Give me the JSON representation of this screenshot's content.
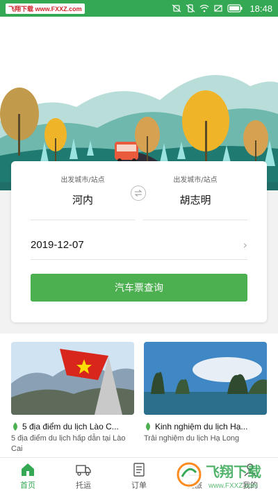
{
  "status_bar": {
    "watermark": "飞翔下载 www.FXXZ.com",
    "time": "18:48"
  },
  "search": {
    "from_label": "出发城市/站点",
    "from_city": "河内",
    "to_label": "出发城市/站点",
    "to_city": "胡志明",
    "date": "2019-12-07",
    "button_label": "汽车票查询"
  },
  "articles": [
    {
      "title": "5 địa điểm du lịch Lào C...",
      "desc": "5 địa điểm du lịch hấp dẫn tại Lào Cai"
    },
    {
      "title": "Kinh nghiệm du lịch Hạ...",
      "desc": "Trải nghiệm du lịch Hạ Long"
    }
  ],
  "tabs": [
    {
      "label": "首页",
      "icon": "home-icon",
      "active": true
    },
    {
      "label": "托运",
      "icon": "truck-icon",
      "active": false
    },
    {
      "label": "订单",
      "icon": "order-list-icon",
      "active": false
    },
    {
      "label": "商旅",
      "icon": "travel-icon",
      "active": false
    },
    {
      "label": "我的",
      "icon": "profile-icon",
      "active": false
    }
  ],
  "overlay_logo": {
    "text": "飞翔下载",
    "url_text": "www.FXXZ.com"
  },
  "colors": {
    "brand_green": "#35a853",
    "button_green": "#4caf50"
  }
}
